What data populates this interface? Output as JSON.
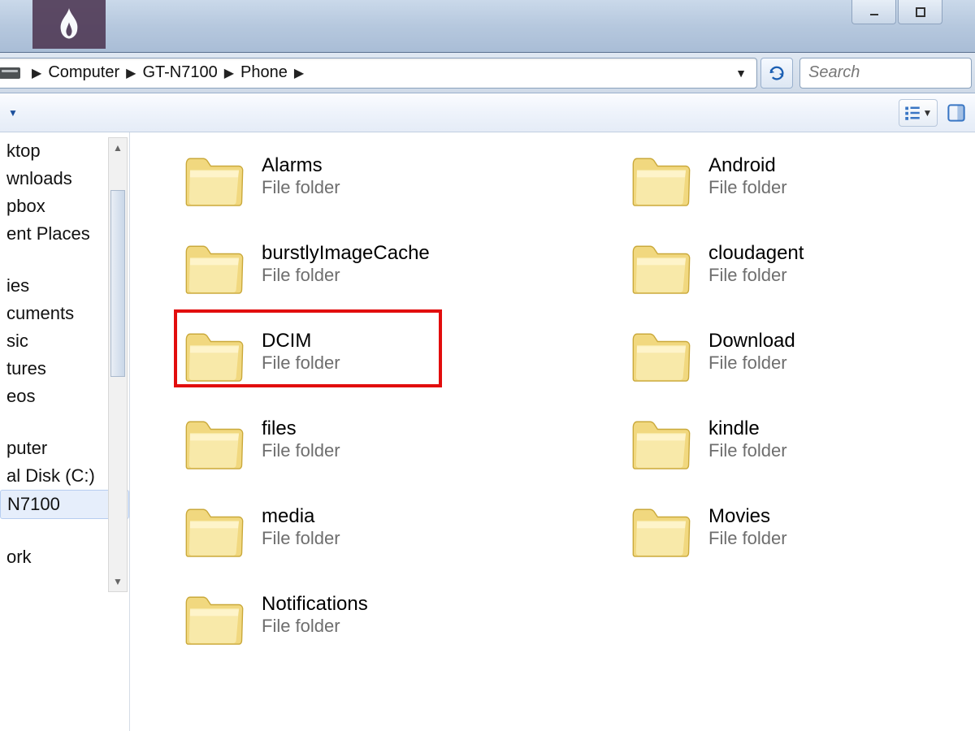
{
  "breadcrumb": {
    "items": [
      "Computer",
      "GT-N7100",
      "Phone"
    ]
  },
  "search": {
    "placeholder": "Search"
  },
  "sidebar": {
    "items": [
      {
        "label": "ktop",
        "selected": false
      },
      {
        "label": "wnloads",
        "selected": false
      },
      {
        "label": "pbox",
        "selected": false
      },
      {
        "label": "ent Places",
        "selected": false
      }
    ],
    "groups2": [
      {
        "label": "ies"
      },
      {
        "label": "cuments"
      },
      {
        "label": "sic"
      },
      {
        "label": "tures"
      },
      {
        "label": "eos"
      }
    ],
    "groups3": [
      {
        "label": "puter"
      },
      {
        "label": "al Disk (C:)"
      },
      {
        "label": "N7100",
        "selected": true
      }
    ],
    "groups4": [
      {
        "label": "ork"
      }
    ]
  },
  "folders_col1": [
    {
      "name": "Alarms",
      "type": "File folder",
      "highlight": false
    },
    {
      "name": "burstlyImageCache",
      "type": "File folder",
      "highlight": false
    },
    {
      "name": "DCIM",
      "type": "File folder",
      "highlight": true
    },
    {
      "name": "files",
      "type": "File folder",
      "highlight": false
    },
    {
      "name": "media",
      "type": "File folder",
      "highlight": false
    },
    {
      "name": "Notifications",
      "type": "File folder",
      "highlight": false
    }
  ],
  "folders_col2": [
    {
      "name": "Android",
      "type": "File folder"
    },
    {
      "name": "cloudagent",
      "type": "File folder"
    },
    {
      "name": "Download",
      "type": "File folder"
    },
    {
      "name": "kindle",
      "type": "File folder"
    },
    {
      "name": "Movies",
      "type": "File folder"
    }
  ]
}
